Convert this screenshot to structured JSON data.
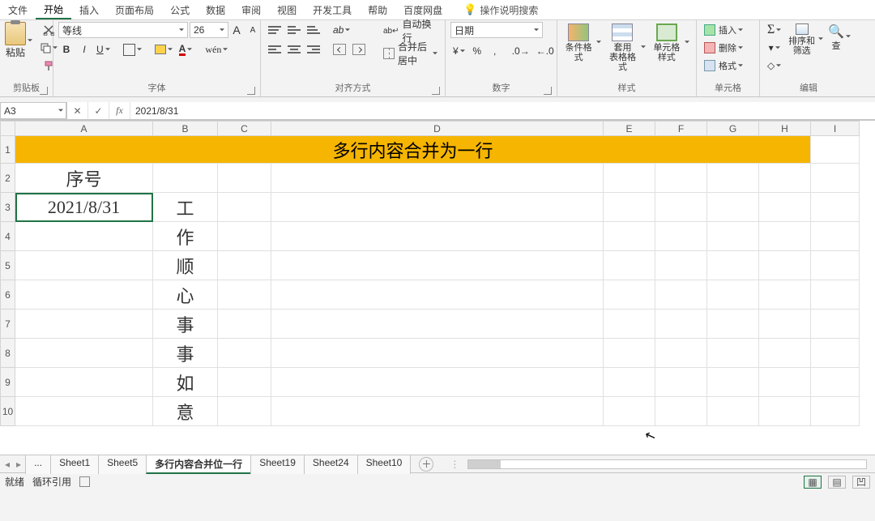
{
  "menu": {
    "items": [
      "文件",
      "开始",
      "插入",
      "页面布局",
      "公式",
      "数据",
      "审阅",
      "视图",
      "开发工具",
      "帮助",
      "百度网盘"
    ],
    "active_index": 1,
    "tell_me": "操作说明搜索"
  },
  "ribbon": {
    "clipboard": {
      "paste": "粘贴",
      "label": "剪贴板"
    },
    "font": {
      "name": "等线",
      "size": "26",
      "bold": "B",
      "italic": "I",
      "underline": "U",
      "label": "字体"
    },
    "alignment": {
      "wrap": "自动换行",
      "merge": "合并后居中",
      "label": "对齐方式"
    },
    "number": {
      "format": "日期",
      "label": "数字"
    },
    "styles": {
      "cond": "条件格式",
      "table": "套用\n表格格式",
      "cell": "单元格样式",
      "label": "样式"
    },
    "cells": {
      "insert": "插入",
      "delete": "删除",
      "format": "格式",
      "label": "单元格"
    },
    "editing": {
      "sort": "排序和筛选",
      "find": "查",
      "label": "编辑"
    }
  },
  "namebox": "A3",
  "formula": "2021/8/31",
  "fx": "fx",
  "columns": [
    "A",
    "B",
    "C",
    "D",
    "E",
    "F",
    "G",
    "H",
    "I"
  ],
  "row_numbers": [
    "1",
    "2",
    "3",
    "4",
    "5",
    "6",
    "7",
    "8",
    "9",
    "10"
  ],
  "title": "多行内容合并为一行",
  "rowsAB": [
    {
      "a": "序号",
      "b": ""
    },
    {
      "a": "2021/8/31",
      "b": "工"
    },
    {
      "a": "",
      "b": "作"
    },
    {
      "a": "",
      "b": "顺"
    },
    {
      "a": "",
      "b": "心"
    },
    {
      "a": "",
      "b": "事"
    },
    {
      "a": "",
      "b": "事"
    },
    {
      "a": "",
      "b": "如"
    },
    {
      "a": "",
      "b": "意"
    }
  ],
  "tabs": {
    "items": [
      "...",
      "Sheet1",
      "Sheet5",
      "多行内容合并位一行",
      "Sheet19",
      "Sheet24",
      "Sheet10"
    ],
    "active_index": 3
  },
  "status": {
    "ready": "就绪",
    "circ": "循环引用"
  },
  "chart_data": null
}
